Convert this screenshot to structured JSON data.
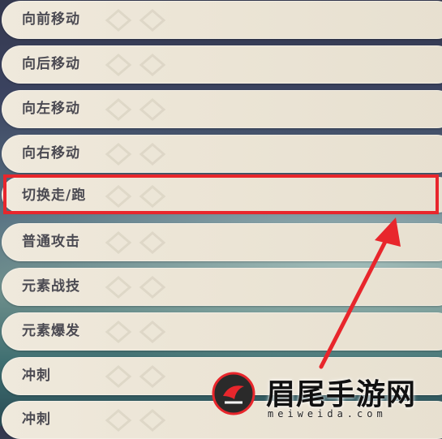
{
  "settings": {
    "keybind_rows": [
      {
        "label": "向前移动"
      },
      {
        "label": "向后移动"
      },
      {
        "label": "向左移动"
      },
      {
        "label": "向右移动"
      },
      {
        "label": "切换走/跑"
      },
      {
        "label": "普通攻击"
      },
      {
        "label": "元素战技"
      },
      {
        "label": "元素爆发"
      },
      {
        "label": "冲刺"
      },
      {
        "label": "冲刺"
      }
    ],
    "highlighted_row": "切换走/跑"
  },
  "watermark": {
    "brand_text": "眉尾手游网",
    "url_text": "meiweida.com"
  },
  "colors": {
    "highlight_border": "#e8262c",
    "row_background": "#ece5d6",
    "label_text": "#4b4a52"
  }
}
